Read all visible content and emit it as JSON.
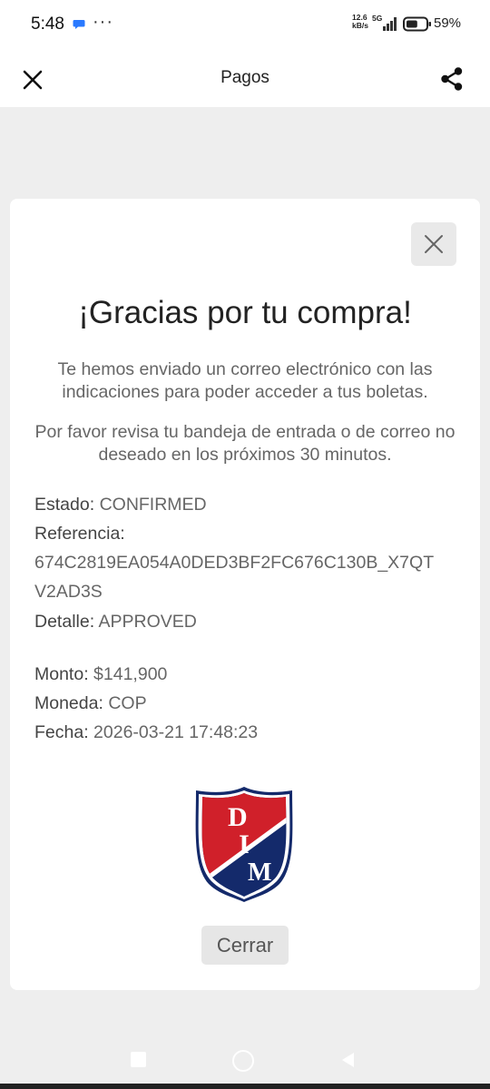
{
  "status_bar": {
    "time": "5:48",
    "net_speed_value": "12.6",
    "net_speed_unit": "kB/s",
    "network_type": "5G",
    "battery_percent": "59%",
    "battery_level": 0.59,
    "more_indicator": "···"
  },
  "app_bar": {
    "title": "Pagos",
    "close_icon": "close-icon",
    "share_icon": "share-icon"
  },
  "receipt": {
    "title": "¡Gracias por tu compra!",
    "message_1": "Te hemos enviado un correo electrónico con las indicaciones para poder acceder a tus boletas.",
    "message_2": "Por favor revisa tu bandeja de entrada o de correo no deseado en los próximos 30 minutos.",
    "estado_label": "Estado:",
    "estado_value": "CONFIRMED",
    "referencia_label": "Referencia:",
    "referencia_line1": "674C2819EA054A0DED3BF2FC676C130B_X7QT",
    "referencia_line2": "V2AD3S",
    "detalle_label": "Detalle:",
    "detalle_value": "APPROVED",
    "monto_label": "Monto:",
    "monto_value": "$141,900",
    "moneda_label": "Moneda:",
    "moneda_value": "COP",
    "fecha_label": "Fecha:",
    "fecha_value": "2026-03-21 17:48:23",
    "logo_letters": [
      "D",
      "I",
      "M"
    ],
    "close_button_label": "Cerrar"
  },
  "colors": {
    "logo_red": "#d0202a",
    "logo_navy": "#142a6b",
    "background": "#eeeeee"
  }
}
